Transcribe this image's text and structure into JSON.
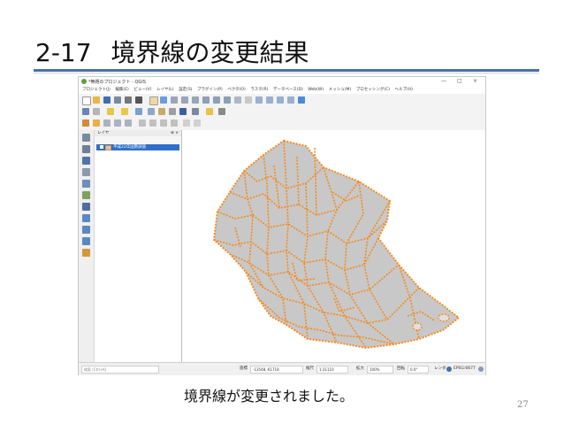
{
  "slide": {
    "number": "2-17",
    "title": "境界線の変更結果",
    "caption": "境界線が変更されました。",
    "page_number": "27"
  },
  "window": {
    "title": "*無題のプロジェクト - QGIS",
    "controls": [
      "—",
      "□",
      "×"
    ],
    "menu": [
      "プロジェクト(J)",
      "編集(E)",
      "ビュー(V)",
      "レイヤ(L)",
      "設定(S)",
      "プラグイン(P)",
      "ベクタ(O)",
      "ラスタ(R)",
      "データベース(D)",
      "Web(W)",
      "メッシュ(M)",
      "プロセッシング(C)",
      "ヘルプ(H)"
    ]
  },
  "layers_panel": {
    "title": "レイヤ",
    "close": "⊗ ×",
    "layer_name": "平成22年国勢調査"
  },
  "statusbar": {
    "search_placeholder": "検索 (Ctrl+K)",
    "coord_label": "座標",
    "coord_value": "-13548,-61718",
    "scale_label": "縮尺",
    "scale_value": "1:31110",
    "magnifier_label": "拡大",
    "magnifier_value": "100%",
    "rotation_label": "回転",
    "rotation_value": "0.0°",
    "render_label": "レンダ",
    "crs_value": "EPSG:6677"
  },
  "colors": {
    "accent_rule": "#4a6fa5",
    "polygon_fill": "#c8c8c8",
    "boundary_line": "#f58a1f",
    "layer_selected": "#2f6fc9"
  }
}
